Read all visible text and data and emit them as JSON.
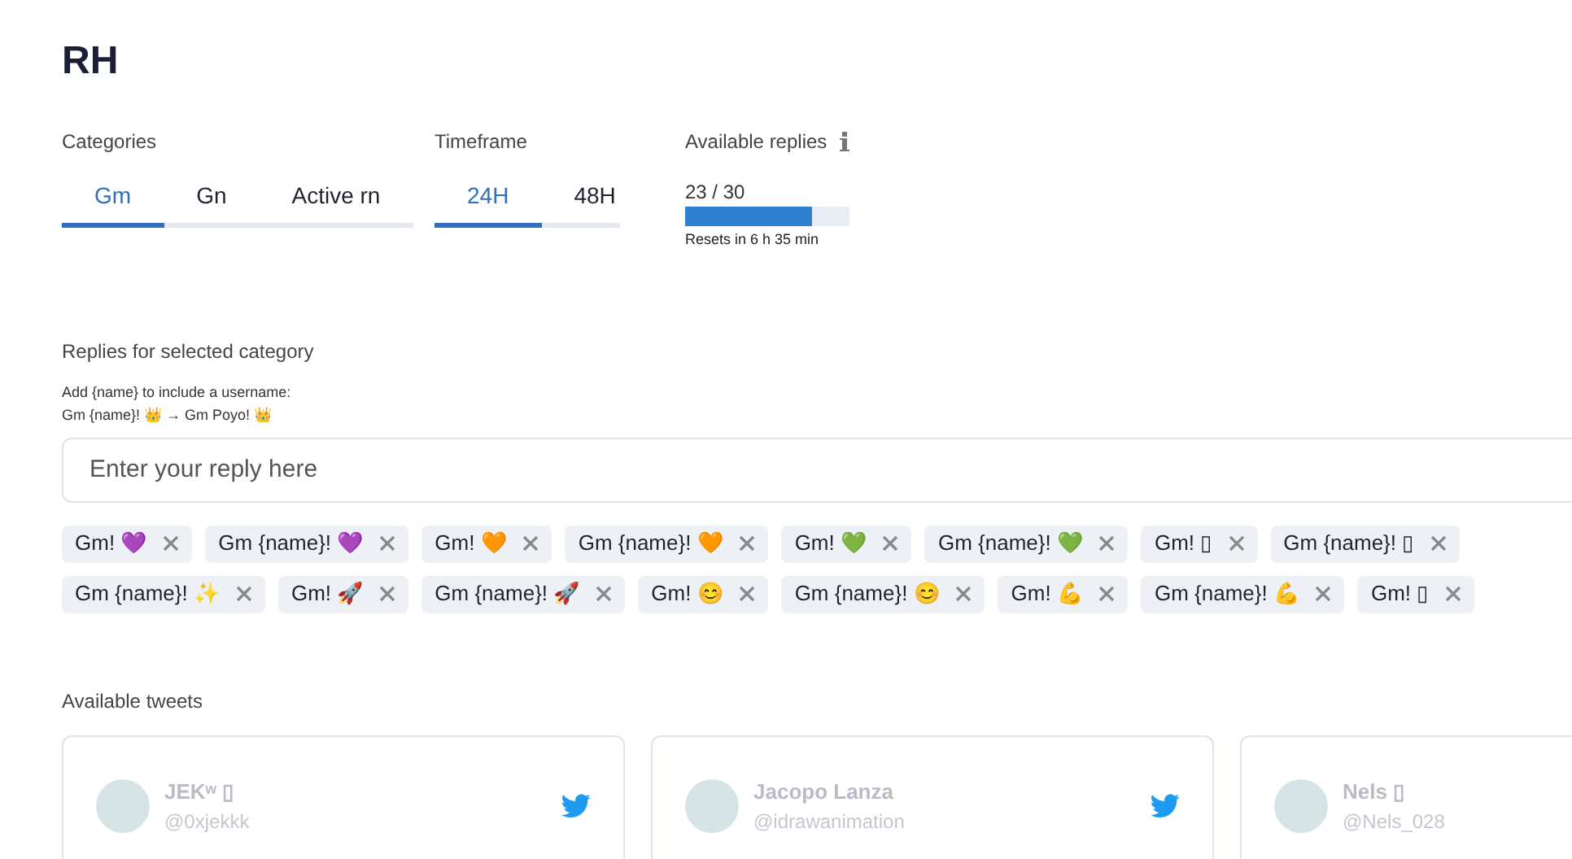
{
  "title": "RH",
  "categories": {
    "label": "Categories",
    "tabs": [
      {
        "label": "Gm",
        "selected": true
      },
      {
        "label": "Gn",
        "selected": false
      },
      {
        "label": "Active rn",
        "selected": false
      }
    ]
  },
  "timeframe": {
    "label": "Timeframe",
    "tabs": [
      {
        "label": "24H",
        "selected": true
      },
      {
        "label": "48H",
        "selected": false
      }
    ]
  },
  "available_replies": {
    "label": "Available replies",
    "reading": "23 / 30",
    "level": 0.77,
    "reset_note": "Resets in 6 h 35 min"
  },
  "replies": {
    "label": "Replies for selected category",
    "hint_lines": [
      "Add {name} to include a username:",
      "Gm {name}! 👑 → Gm Poyo! 👑"
    ],
    "input": {
      "placeholder": "Enter your reply here"
    },
    "chip_rows": [
      [
        "Gm! 💜",
        "Gm {name}! 💜",
        "Gm! 🧡",
        "Gm {name}! 🧡",
        "Gm! 💚",
        "Gm {name}! 💚",
        "Gm! ▯",
        "Gm {name}! ▯"
      ],
      [
        "Gm {name}! ✨",
        "Gm! 🚀",
        "Gm {name}! 🚀",
        "Gm! 😊",
        "Gm {name}! 😊",
        "Gm! 💪",
        "Gm {name}! 💪",
        "Gm! ▯"
      ]
    ]
  },
  "tweets": {
    "label": "Available tweets",
    "cards": [
      {
        "name": "JEKʷ ▯",
        "handle": "@0xjekkk"
      },
      {
        "name": "Jacopo Lanza",
        "handle": "@idrawanimation"
      },
      {
        "name": "Nels ▯",
        "handle": "@Nels_028"
      }
    ]
  }
}
